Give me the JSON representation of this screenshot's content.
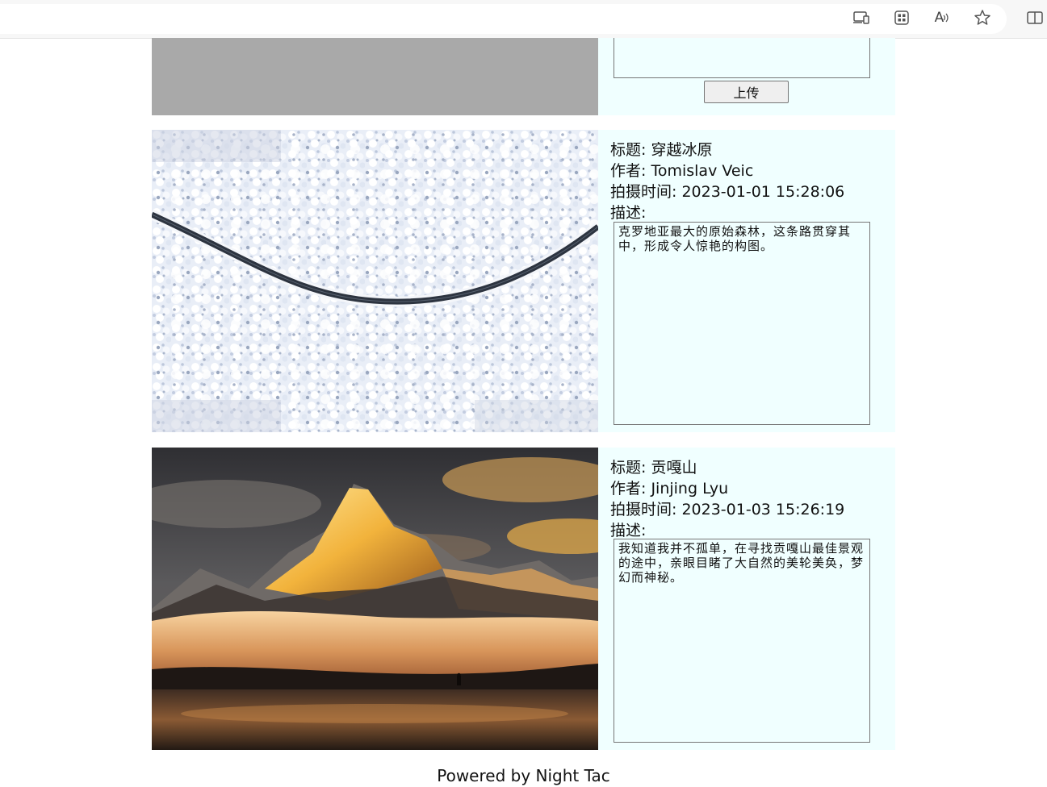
{
  "browser": {
    "icons": [
      "device-icon",
      "apps-icon",
      "read-aloud-icon",
      "favorite-star-icon",
      "split-screen-icon"
    ],
    "read_aloud_glyph": "A"
  },
  "upload_section": {
    "upload_label": "上传"
  },
  "posts": [
    {
      "title_prefix": "标题:",
      "title": "穿越冰原",
      "author_prefix": "作者:",
      "author": "Tomislav Veic",
      "time_prefix": "拍摄时间:",
      "time": "2023-01-01 15:28:06",
      "desc_prefix": "描述:",
      "description": "克罗地亚最大的原始森林，这条路贯穿其中，形成令人惊艳的构图。"
    },
    {
      "title_prefix": "标题:",
      "title": "贡嘎山",
      "author_prefix": "作者:",
      "author": "Jinjing Lyu",
      "time_prefix": "拍摄时间:",
      "time": "2023-01-03 15:26:19",
      "desc_prefix": "描述:",
      "description": "我知道我并不孤单，在寻找贡嘎山最佳景观的途中，亲眼目睹了大自然的美轮美奂，梦幻而神秘。"
    }
  ],
  "footer": {
    "text": "Powered by Night Tac"
  },
  "colors": {
    "card_background": "#f0ffff",
    "placeholder_gray": "#a9a9a9"
  }
}
